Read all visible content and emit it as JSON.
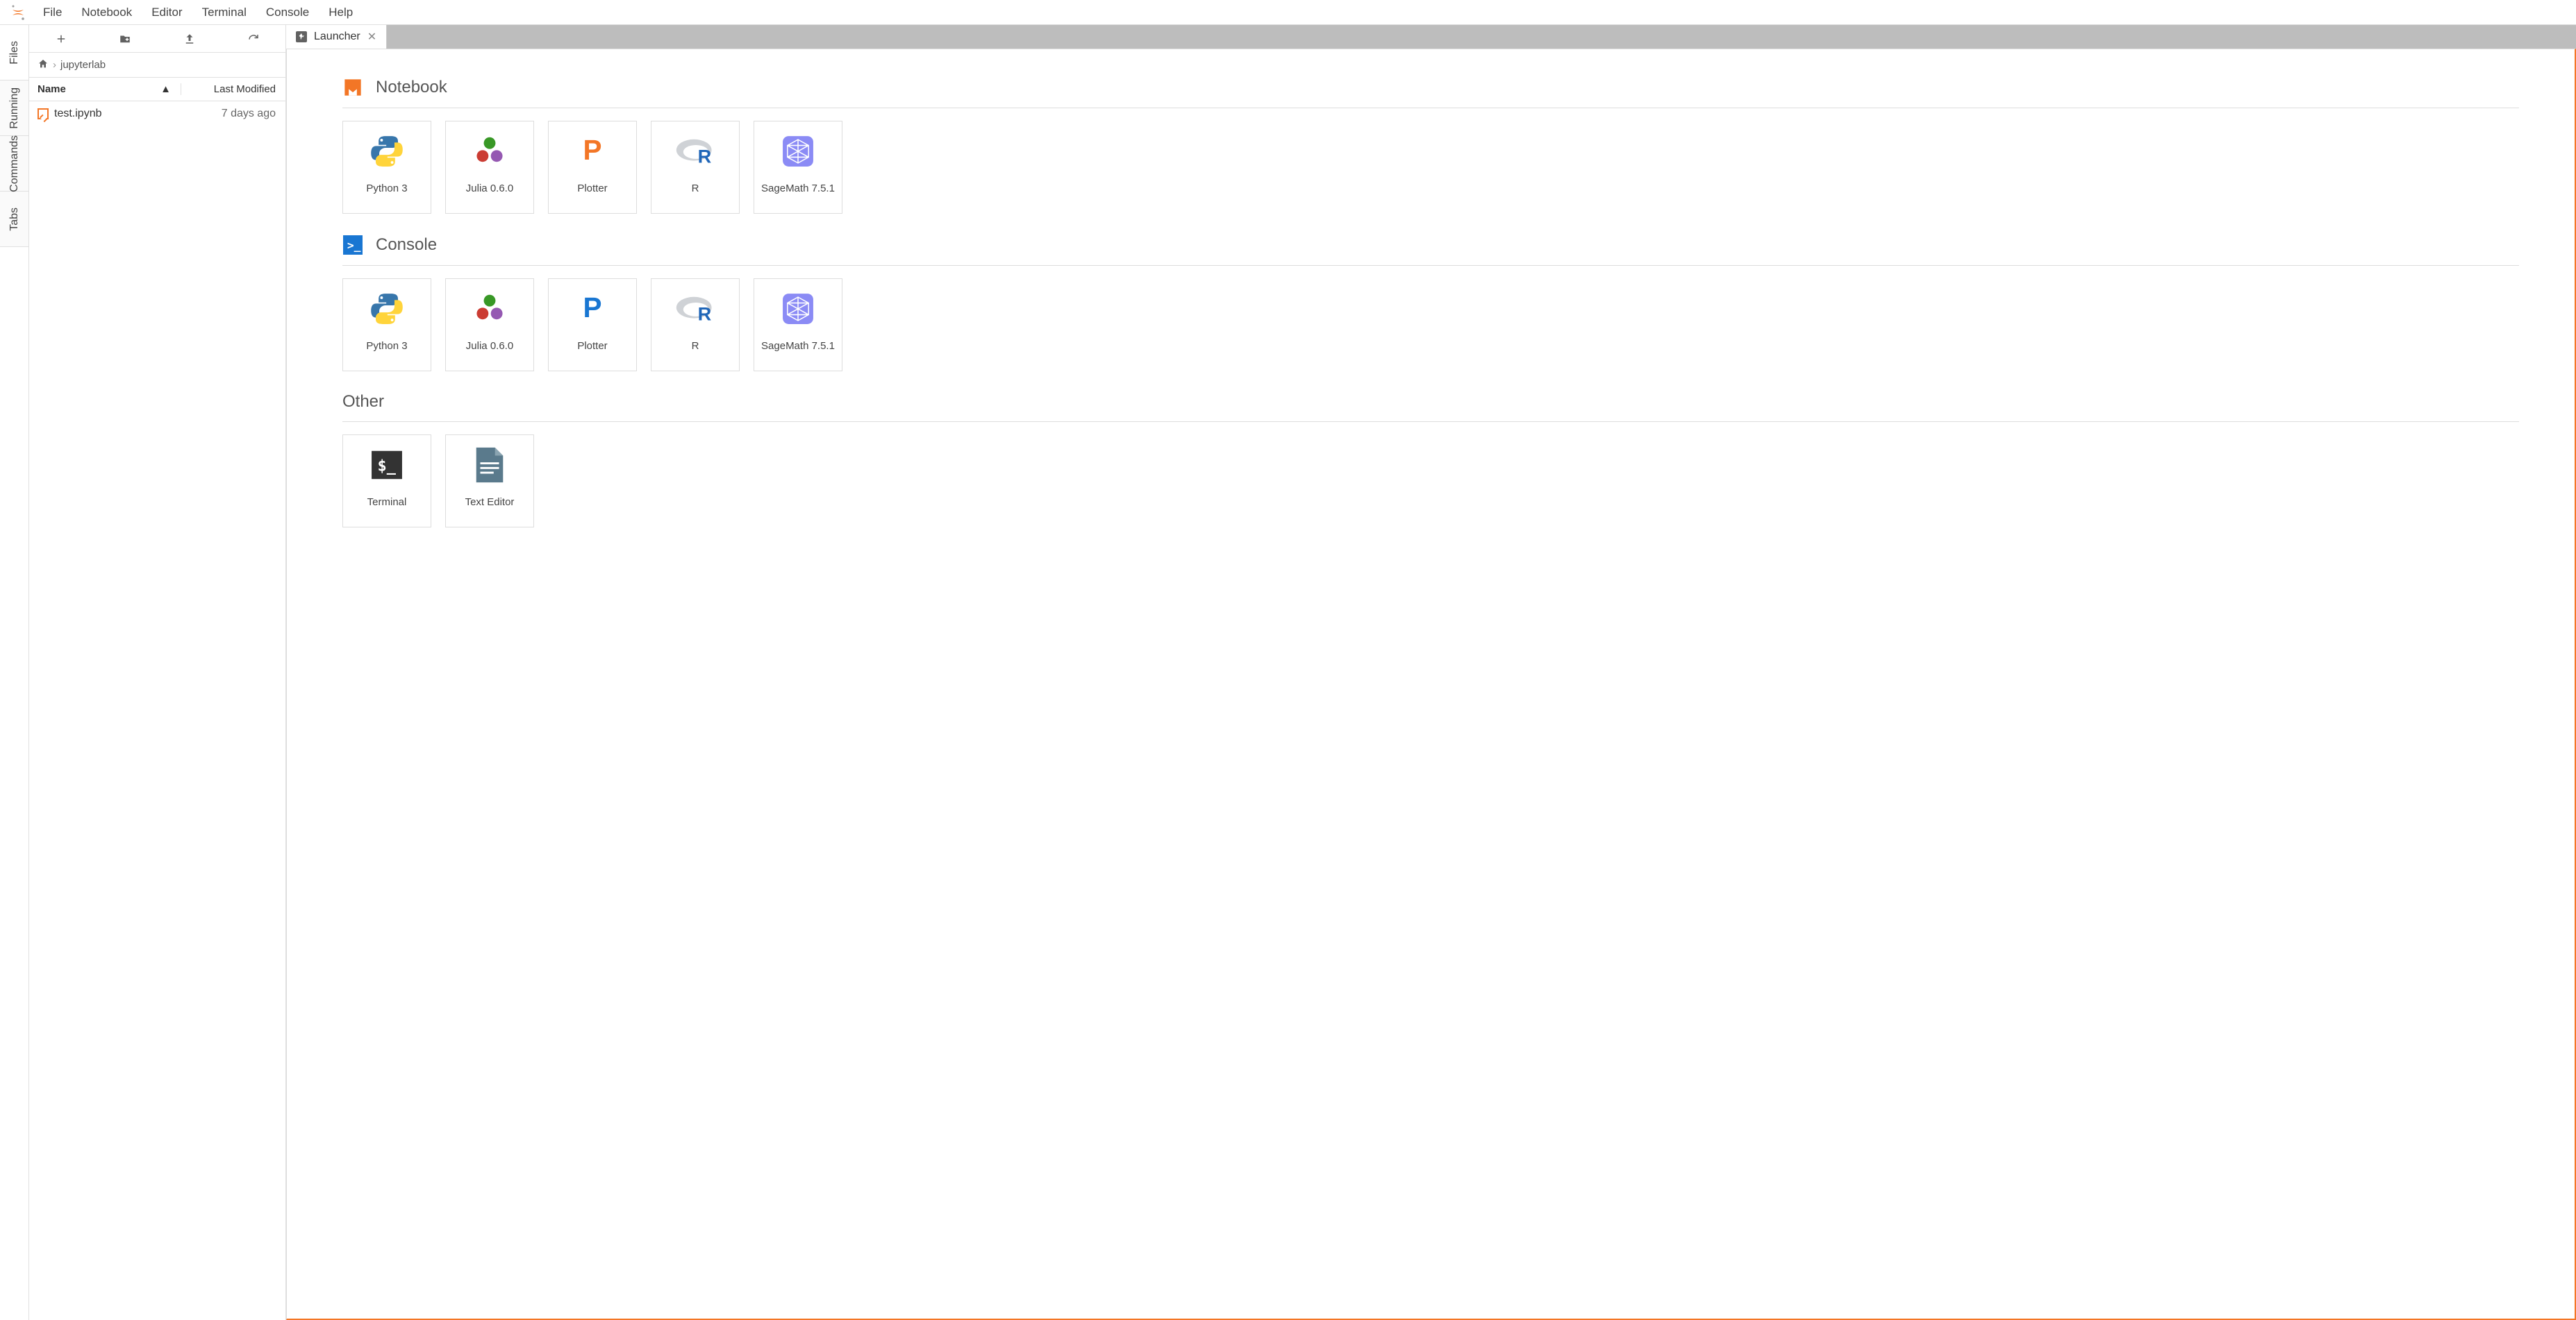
{
  "menu": {
    "items": [
      "File",
      "Notebook",
      "Editor",
      "Terminal",
      "Console",
      "Help"
    ]
  },
  "sidetabs": [
    "Files",
    "Running",
    "Commands",
    "Tabs"
  ],
  "filebrowser": {
    "breadcrumb": [
      "jupyterlab"
    ],
    "columns": {
      "name": "Name",
      "modified": "Last Modified"
    },
    "files": [
      {
        "name": "test.ipynb",
        "modified": "7 days ago",
        "kind": "notebook"
      }
    ]
  },
  "tabs": [
    {
      "label": "Launcher"
    }
  ],
  "launcher": {
    "sections": [
      {
        "title": "Notebook",
        "icon": "notebook",
        "cards": [
          {
            "label": "Python 3",
            "icon": "python"
          },
          {
            "label": "Julia 0.6.0",
            "icon": "julia"
          },
          {
            "label": "Plotter",
            "icon": "plotter-orange"
          },
          {
            "label": "R",
            "icon": "r"
          },
          {
            "label": "SageMath 7.5.1",
            "icon": "sage"
          }
        ]
      },
      {
        "title": "Console",
        "icon": "console",
        "cards": [
          {
            "label": "Python 3",
            "icon": "python"
          },
          {
            "label": "Julia 0.6.0",
            "icon": "julia"
          },
          {
            "label": "Plotter",
            "icon": "plotter-blue"
          },
          {
            "label": "R",
            "icon": "r"
          },
          {
            "label": "SageMath 7.5.1",
            "icon": "sage"
          }
        ]
      },
      {
        "title": "Other",
        "icon": "",
        "cards": [
          {
            "label": "Terminal",
            "icon": "terminal"
          },
          {
            "label": "Text Editor",
            "icon": "texteditor"
          }
        ]
      }
    ]
  }
}
